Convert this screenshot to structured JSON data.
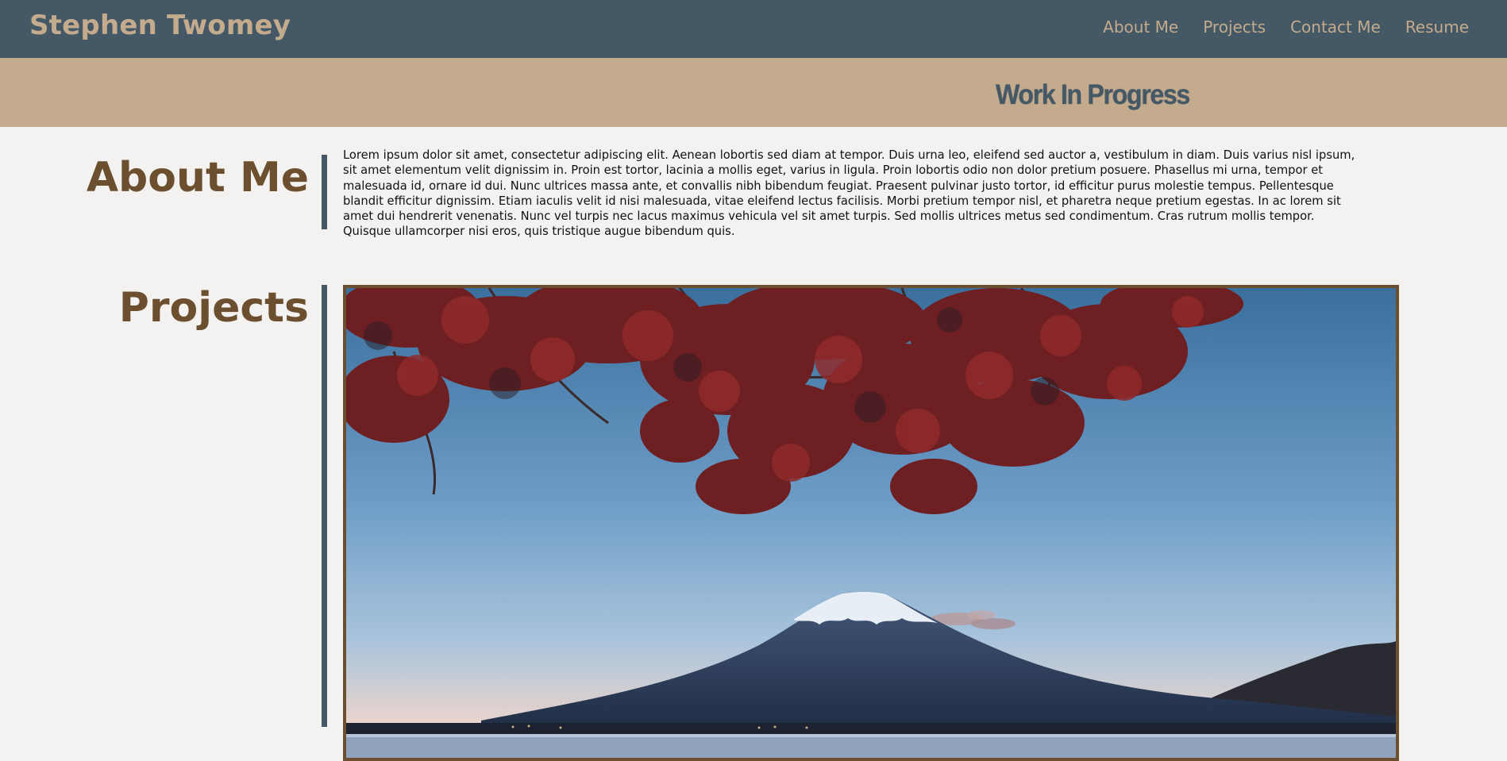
{
  "navbar": {
    "brand": "Stephen Twomey",
    "links": [
      "About Me",
      "Projects",
      "Contact Me",
      "Resume"
    ]
  },
  "banner": {
    "text": "Work In Progress"
  },
  "about": {
    "title": "About Me",
    "body": "Lorem ipsum dolor sit amet, consectetur adipiscing elit. Aenean lobortis sed diam at tempor. Duis urna leo, eleifend sed auctor a, vestibulum in diam. Duis varius nisl ipsum, sit amet elementum velit dignissim in. Proin est tortor, lacinia a mollis eget, varius in ligula. Proin lobortis odio non dolor pretium posuere. Phasellus mi urna, tempor et malesuada id, ornare id dui. Nunc ultrices massa ante, et convallis nibh bibendum feugiat. Praesent pulvinar justo tortor, id efficitur purus molestie tempus. Pellentesque blandit efficitur dignissim. Etiam iaculis velit id nisi malesuada, vitae eleifend lectus facilisis. Morbi pretium tempor nisl, et pharetra neque pretium egestas. In ac lorem sit amet dui hendrerit venenatis. Nunc vel turpis nec lacus maximus vehicula vel sit amet turpis. Sed mollis ultrices metus sed condimentum. Cras rutrum mollis tempor. Quisque ullamcorper nisi eros, quis tristique augue bibendum quis."
  },
  "projects": {
    "title": "Projects",
    "image": "mount-fuji-autumn-maple-photo"
  },
  "colors": {
    "navbar_bg": "#455866",
    "accent_tan": "#c4ab8d",
    "heading_brown": "#6b4f2e",
    "page_bg": "#f4f2f0"
  }
}
